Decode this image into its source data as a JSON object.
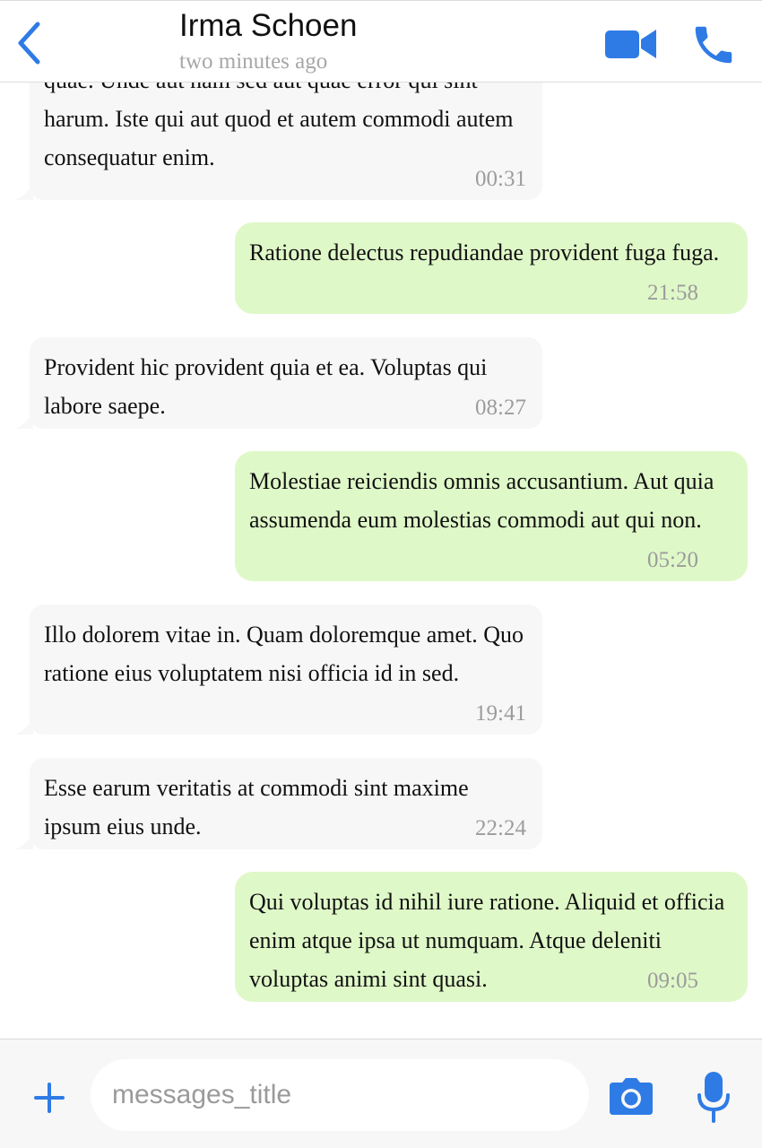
{
  "header": {
    "contact_name": "Irma Schoen",
    "status": "two minutes ago",
    "icons": {
      "back": "chevron-left-icon",
      "video": "video-camera-icon",
      "call": "phone-icon"
    }
  },
  "messages": [
    {
      "direction": "incoming",
      "text": "quae. Unde aut nam sed aut quae error qui sint harum. Iste qui aut quod et autem commodi autem consequatur enim.",
      "time": "00:31"
    },
    {
      "direction": "outgoing",
      "text": "Ratione delectus repudiandae provident fuga fuga.",
      "time": "21:58"
    },
    {
      "direction": "incoming",
      "text": "Provident hic provident quia et ea. Voluptas qui labore saepe.",
      "time": "08:27"
    },
    {
      "direction": "outgoing",
      "text": "Molestiae reiciendis omnis accusantium. Aut quia assumenda eum molestias commodi aut qui non.",
      "time": "05:20"
    },
    {
      "direction": "incoming",
      "text": "Illo dolorem vitae in. Quam doloremque amet. Quo ratione eius voluptatem nisi officia id in sed.",
      "time": "19:41"
    },
    {
      "direction": "incoming",
      "text": "Esse earum veritatis at commodi sint maxime ipsum eius unde.",
      "time": "22:24"
    },
    {
      "direction": "outgoing",
      "text": "Qui voluptas id nihil iure ratione. Aliquid et officia enim atque ipsa ut numquam. Atque deleniti voluptas animi sint quasi.",
      "time": "09:05"
    }
  ],
  "composer": {
    "placeholder": "messages_title",
    "value": "",
    "icons": {
      "add": "plus-icon",
      "camera": "camera-icon",
      "mic": "microphone-icon"
    }
  },
  "colors": {
    "accent": "#2f7be5",
    "incoming_bubble": "#f7f7f8",
    "outgoing_bubble": "#dff8c8",
    "timestamp": "#9c9c9c"
  }
}
